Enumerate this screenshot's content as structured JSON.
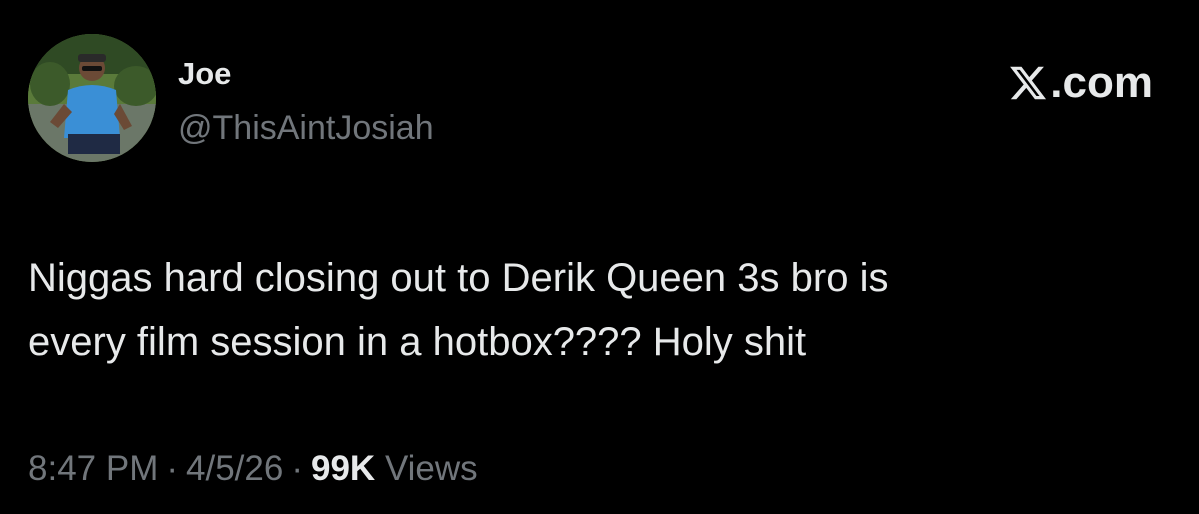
{
  "author": {
    "display_name": "Joe",
    "handle": "@ThisAintJosiah",
    "avatar_icon": "profile-photo"
  },
  "brand": {
    "icon": "x-logo-icon",
    "domain": ".com"
  },
  "tweet": {
    "text": "Niggas hard closing out to Derik Queen 3s bro is\nevery film session in a hotbox???? Holy shit"
  },
  "meta": {
    "time": "8:47 PM",
    "date": "4/5/26",
    "separator": "·",
    "views_count": "99K",
    "views_label": "Views"
  },
  "colors": {
    "background": "#000000",
    "primary_text": "#e7e9ea",
    "secondary_text": "#71767b"
  }
}
